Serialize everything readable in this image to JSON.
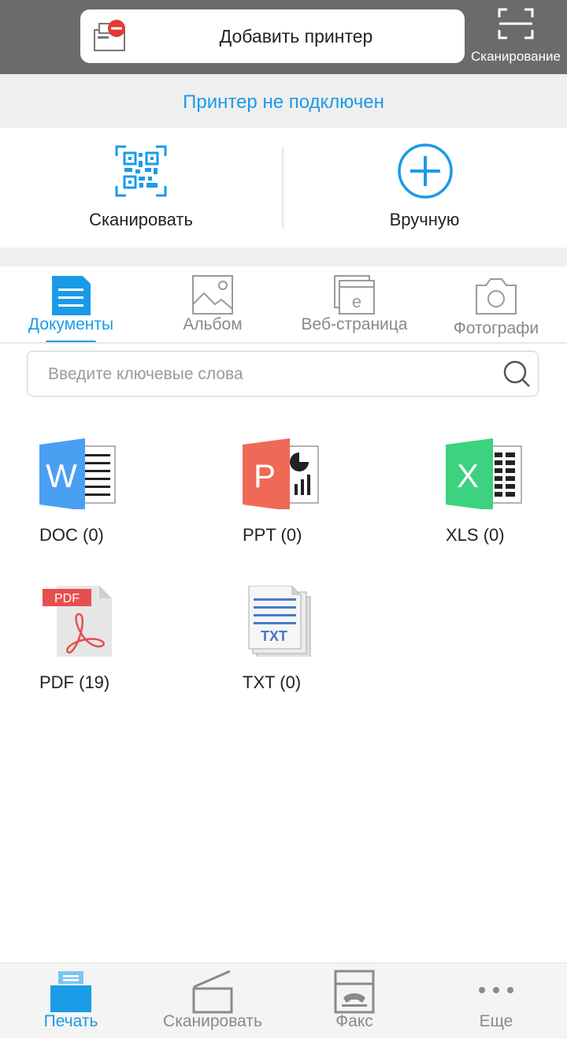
{
  "header": {
    "add_printer_label": "Добавить принтер",
    "scan_label": "Сканирование"
  },
  "status": {
    "text": "Принтер не подключен"
  },
  "connect": {
    "scan_label": "Сканировать",
    "manual_label": "Вручную"
  },
  "tabs": [
    {
      "label": "Документы",
      "active": true,
      "icon": "document-icon"
    },
    {
      "label": "Альбом",
      "active": false,
      "icon": "image-icon"
    },
    {
      "label": "Веб-страница",
      "active": false,
      "icon": "webpage-icon"
    },
    {
      "label": "Фотографи",
      "active": false,
      "icon": "camera-icon"
    }
  ],
  "search": {
    "placeholder": "Введите ключевые слова",
    "value": ""
  },
  "files": [
    {
      "label": "DOC (0)",
      "icon": "word-icon"
    },
    {
      "label": "PPT (0)",
      "icon": "powerpoint-icon"
    },
    {
      "label": "XLS (0)",
      "icon": "excel-icon"
    },
    {
      "label": "PDF (19)",
      "icon": "pdf-icon",
      "badge": "PDF"
    },
    {
      "label": "TXT (0)",
      "icon": "txt-icon",
      "badge": "TXT"
    }
  ],
  "bottom_nav": [
    {
      "label": "Печать",
      "active": true,
      "icon": "print-icon"
    },
    {
      "label": "Сканировать",
      "active": false,
      "icon": "scanner-icon"
    },
    {
      "label": "Факс",
      "active": false,
      "icon": "fax-icon"
    },
    {
      "label": "Еще",
      "active": false,
      "icon": "more-icon"
    }
  ],
  "colors": {
    "accent": "#1a9be8",
    "header_bg": "#6b6b6b",
    "word": "#4b9ff2",
    "ppt": "#ef6a56",
    "xls": "#3cd27f",
    "pdf": "#e84e4e"
  }
}
